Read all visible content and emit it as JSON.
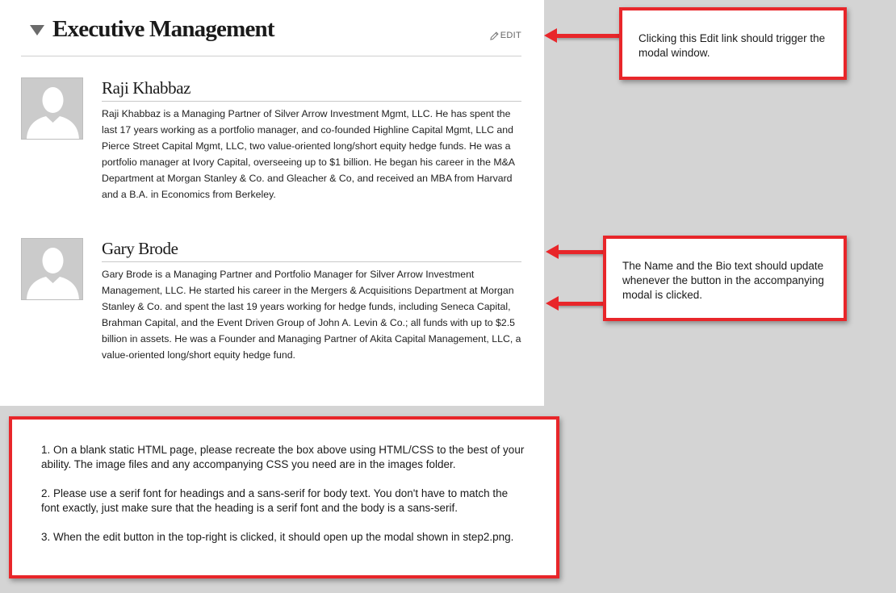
{
  "section": {
    "title": "Executive Management",
    "edit_label": "EDIT"
  },
  "people": [
    {
      "name": "Raji Khabbaz",
      "bio": "Raji Khabbaz is a Managing Partner of Silver Arrow Investment Mgmt, LLC. He has spent the last 17 years working as a portfolio manager, and co-founded Highline Capital Mgmt, LLC and Pierce Street Capital Mgmt, LLC, two value-oriented long/short equity hedge funds. He was a portfolio manager at Ivory Capital, overseeing up to $1 billion. He began his career in the M&A Department at Morgan Stanley & Co. and Gleacher & Co, and received an MBA from Harvard and a B.A. in Economics from Berkeley."
    },
    {
      "name": "Gary Brode",
      "bio": "Gary Brode is a Managing Partner and Portfolio Manager for Silver Arrow Investment Management, LLC. He started his career in the Mergers & Acquisitions Department at Morgan Stanley & Co. and spent the last 19 years working for hedge funds, including Seneca Capital, Brahman Capital, and the Event Driven Group of John A. Levin & Co.; all funds with up to $2.5 billion in assets. He was a Founder and Managing Partner of Akita Capital Management, LLC, a value-oriented long/short equity hedge fund."
    }
  ],
  "callouts": {
    "edit": "Clicking this Edit link should trigger the modal window.",
    "name_bio": "The Name and the Bio text should update whenever the button in the accompanying modal is clicked.",
    "instructions": [
      "1. On a blank static HTML page, please recreate the box above using HTML/CSS to the best of your ability. The image files and any accompanying CSS you need are in the images folder.",
      "2. Please use a serif font for headings and a sans-serif for body text. You don't have to match the font exactly, just make sure that the heading is a serif font and the body is a sans-serif.",
      "3. When the edit button in the top-right is clicked, it should open up the modal shown in step2.png."
    ]
  },
  "colors": {
    "callout_border": "#e8262a",
    "background": "#d4d4d4",
    "avatar": "#c8c8c8"
  },
  "icons": {
    "collapse": "triangle-down-icon",
    "edit": "pencil-icon",
    "avatar": "person-silhouette-icon"
  }
}
